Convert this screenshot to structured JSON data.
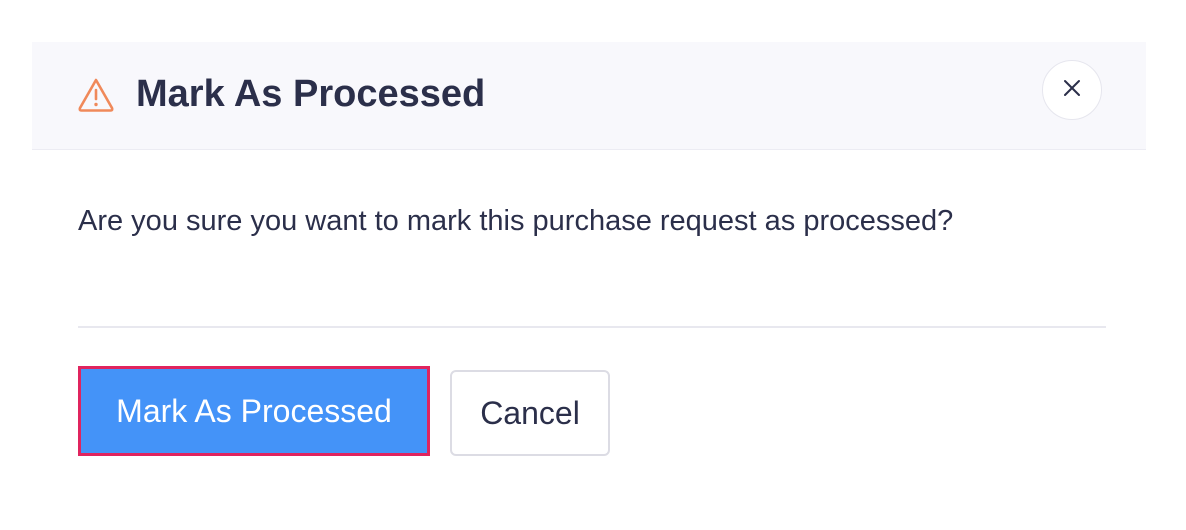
{
  "dialog": {
    "title": "Mark As Processed",
    "title_icon": "warning-triangle-icon",
    "close_icon": "close-icon",
    "message": "Are you sure you want to mark this purchase request as processed?",
    "confirm_label": "Mark As Processed",
    "cancel_label": "Cancel"
  },
  "colors": {
    "primary": "#4493f8",
    "focus_outline": "#e0245e",
    "warning": "#f0895a",
    "text": "#2b2f4a",
    "header_bg": "#f8f8fc"
  }
}
